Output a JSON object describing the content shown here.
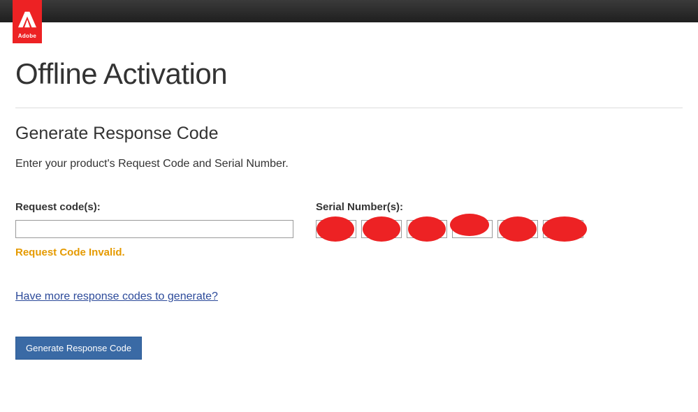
{
  "brand": "Adobe",
  "page": {
    "title": "Offline Activation",
    "section_heading": "Generate Response Code",
    "instruction": "Enter your product's Request Code and Serial Number."
  },
  "form": {
    "request": {
      "label": "Request code(s):",
      "value": "",
      "error": "Request Code Invalid."
    },
    "serial": {
      "label": "Serial Number(s):",
      "segments": [
        "",
        "",
        "",
        "",
        "",
        ""
      ]
    },
    "more_link": "Have more response codes to generate?",
    "submit_label": "Generate Response Code"
  }
}
